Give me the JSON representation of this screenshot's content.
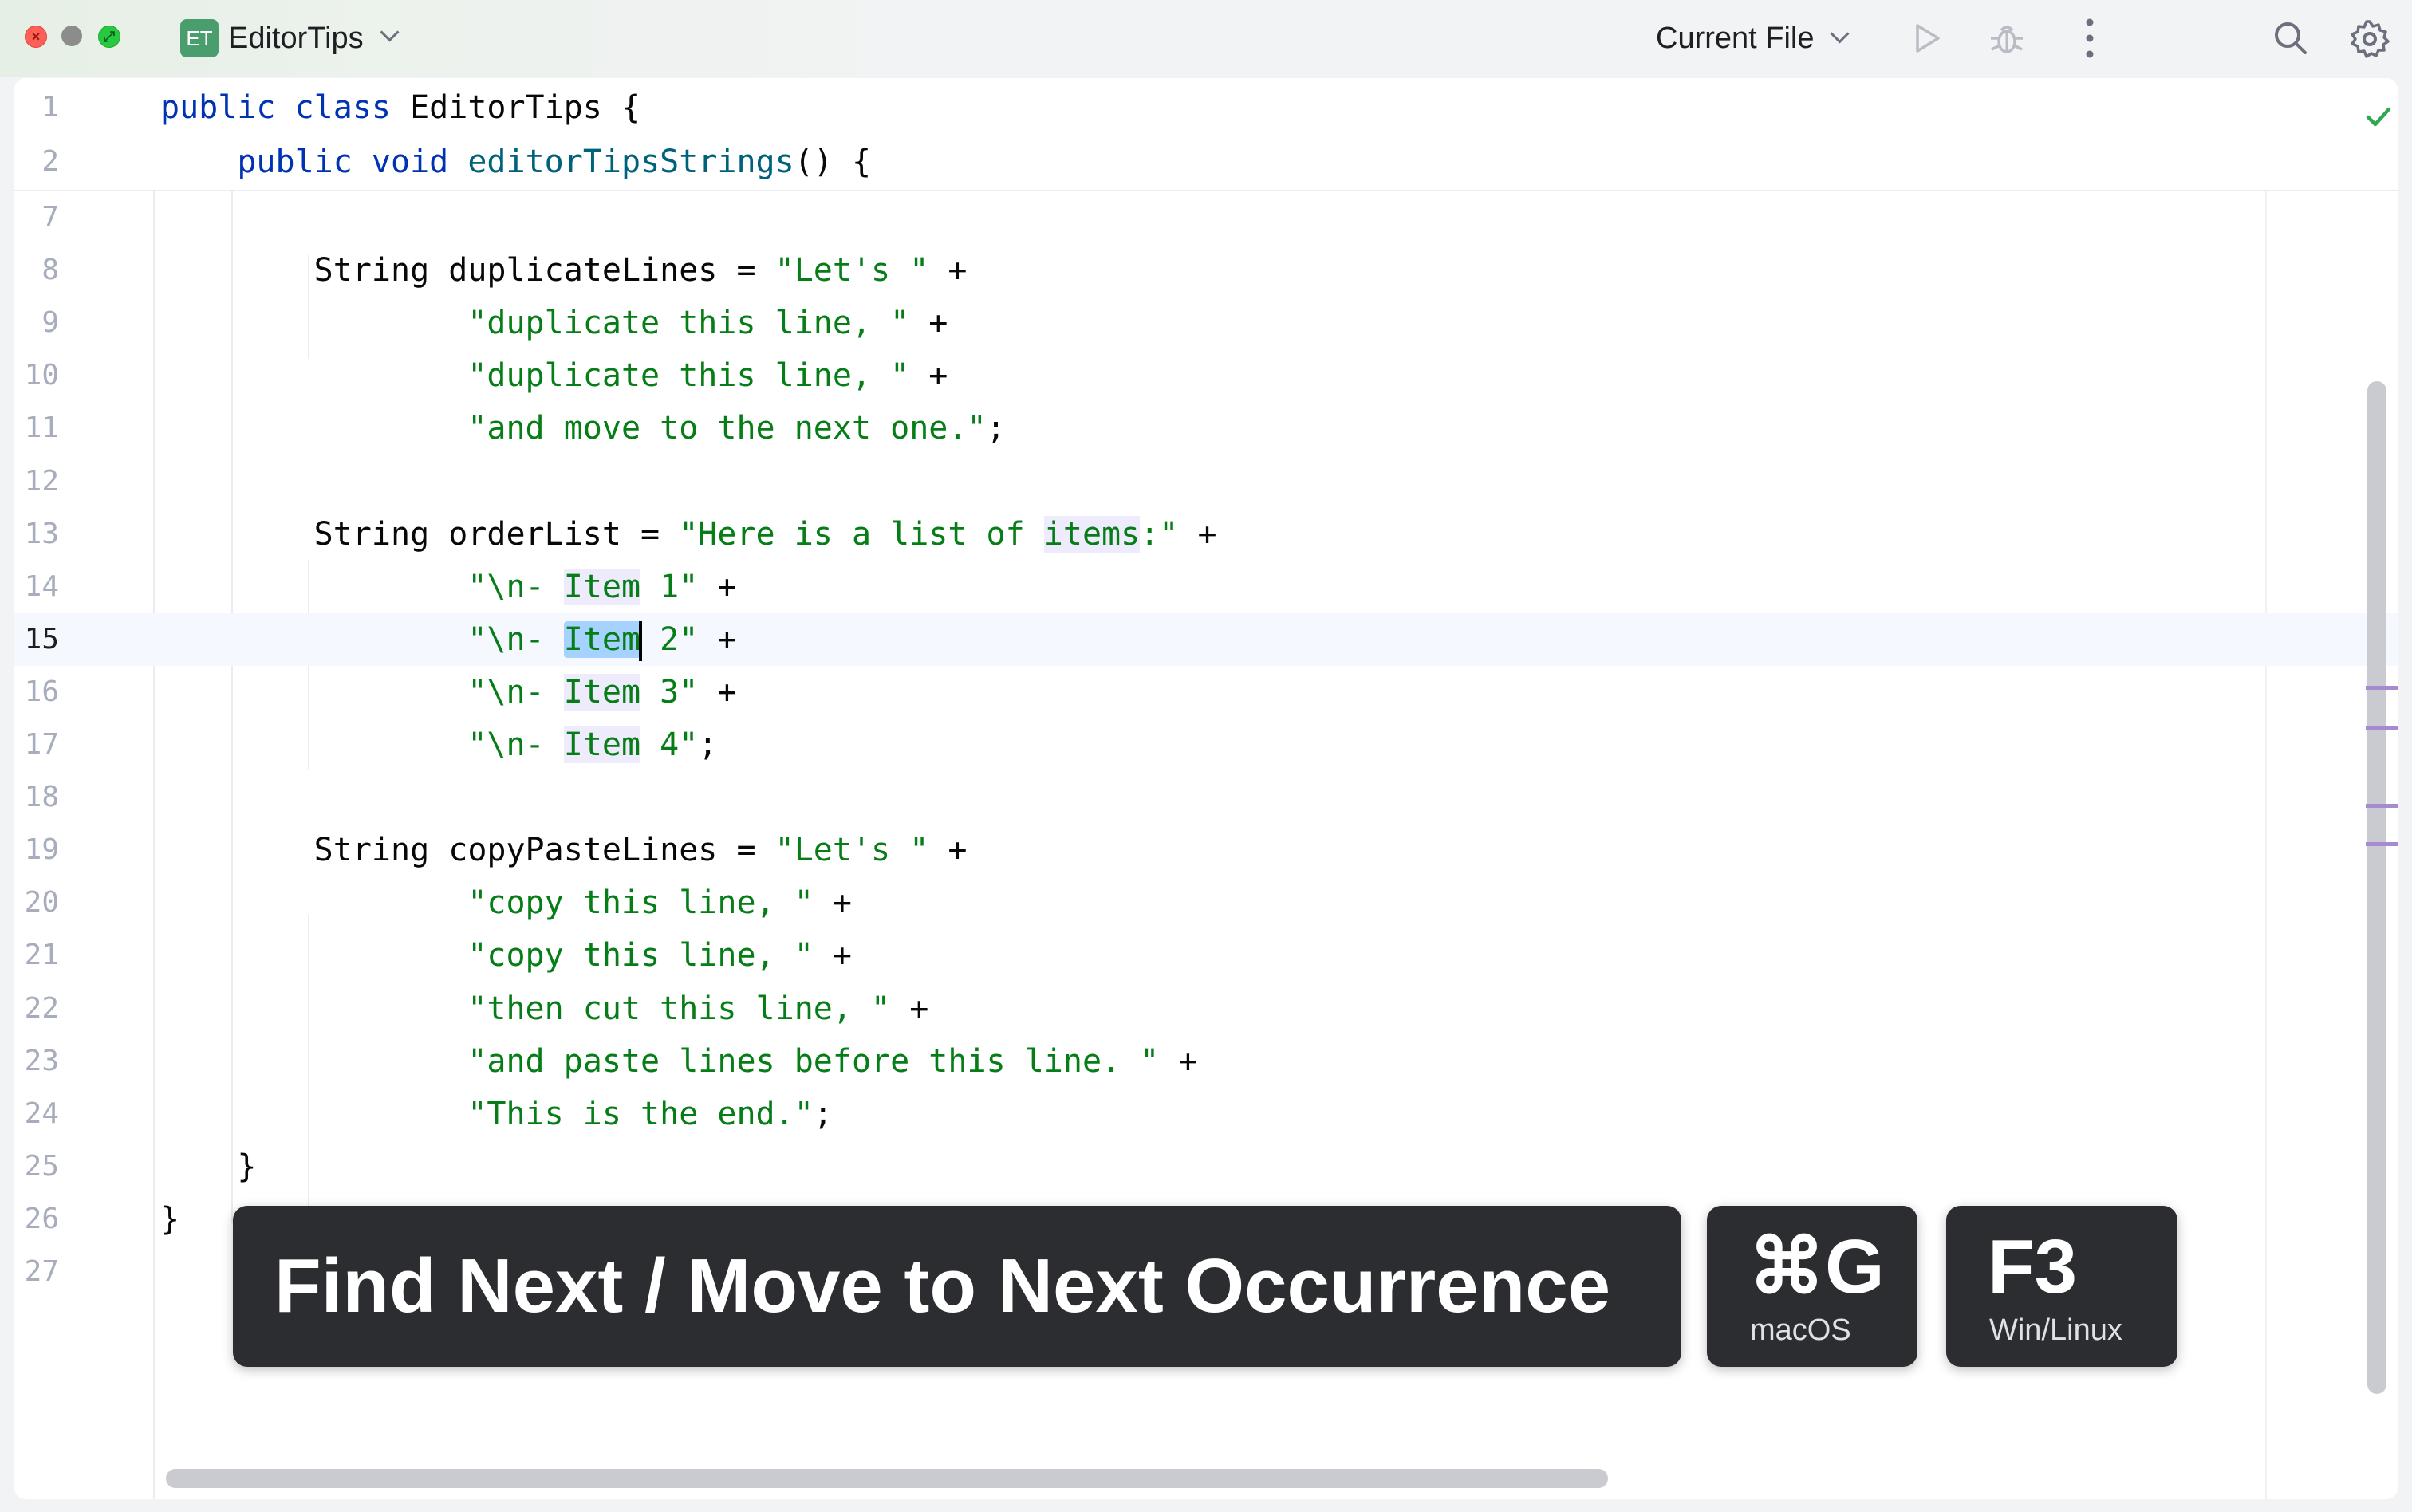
{
  "titlebar": {
    "project_badge": "ET",
    "project_name": "EditorTips",
    "run_config": "Current File",
    "icons": [
      "close-window-icon",
      "minimize-window-icon",
      "zoom-window-icon",
      "chevron-down-icon",
      "run-icon",
      "debug-icon",
      "more-vertical-icon",
      "search-icon",
      "gear-icon"
    ]
  },
  "editor": {
    "status_icon": "check-icon",
    "current_line": "15",
    "sticky_lines": [
      {
        "num": "1",
        "tokens": [
          {
            "t": "public class",
            "c": "kw"
          },
          {
            "t": " EditorTips {",
            "c": ""
          }
        ]
      },
      {
        "num": "2",
        "tokens": [
          {
            "t": "    public void",
            "c": "kw"
          },
          {
            "t": " ",
            "c": ""
          },
          {
            "t": "editorTipsStrings",
            "c": "fn"
          },
          {
            "t": "() {",
            "c": ""
          }
        ]
      }
    ],
    "lines": [
      {
        "num": "7",
        "tokens": []
      },
      {
        "num": "8",
        "tokens": [
          {
            "t": "        String duplicateLines = ",
            "c": ""
          },
          {
            "t": "\"Let's \"",
            "c": "str"
          },
          {
            "t": " +",
            "c": ""
          }
        ]
      },
      {
        "num": "9",
        "tokens": [
          {
            "t": "                ",
            "c": ""
          },
          {
            "t": "\"duplicate this line, \"",
            "c": "str"
          },
          {
            "t": " +",
            "c": ""
          }
        ]
      },
      {
        "num": "10",
        "tokens": [
          {
            "t": "                ",
            "c": ""
          },
          {
            "t": "\"duplicate this line, \"",
            "c": "str"
          },
          {
            "t": " +",
            "c": ""
          }
        ]
      },
      {
        "num": "11",
        "tokens": [
          {
            "t": "                ",
            "c": ""
          },
          {
            "t": "\"and move to the next one.\"",
            "c": "str"
          },
          {
            "t": ";",
            "c": ""
          }
        ]
      },
      {
        "num": "12",
        "tokens": []
      },
      {
        "num": "13",
        "tokens": [
          {
            "t": "        String orderList = ",
            "c": ""
          },
          {
            "t": "\"Here is a list of ",
            "c": "str"
          },
          {
            "t": "items",
            "c": "str occ"
          },
          {
            "t": ":\"",
            "c": "str"
          },
          {
            "t": " +",
            "c": ""
          }
        ]
      },
      {
        "num": "14",
        "tokens": [
          {
            "t": "                ",
            "c": ""
          },
          {
            "t": "\"\\n- ",
            "c": "str"
          },
          {
            "t": "Item",
            "c": "str occ"
          },
          {
            "t": " 1\"",
            "c": "str"
          },
          {
            "t": " +",
            "c": ""
          }
        ]
      },
      {
        "num": "15",
        "tokens": [
          {
            "t": "                ",
            "c": ""
          },
          {
            "t": "\"\\n- ",
            "c": "str"
          },
          {
            "t": "Item",
            "c": "str sel"
          },
          {
            "t": "",
            "c": "caret"
          },
          {
            "t": " 2\"",
            "c": "str"
          },
          {
            "t": " +",
            "c": ""
          }
        ]
      },
      {
        "num": "16",
        "tokens": [
          {
            "t": "                ",
            "c": ""
          },
          {
            "t": "\"\\n- ",
            "c": "str"
          },
          {
            "t": "Item",
            "c": "str occ"
          },
          {
            "t": " 3\"",
            "c": "str"
          },
          {
            "t": " +",
            "c": ""
          }
        ]
      },
      {
        "num": "17",
        "tokens": [
          {
            "t": "                ",
            "c": ""
          },
          {
            "t": "\"\\n- ",
            "c": "str"
          },
          {
            "t": "Item",
            "c": "str occ"
          },
          {
            "t": " 4\"",
            "c": "str"
          },
          {
            "t": ";",
            "c": ""
          }
        ]
      },
      {
        "num": "18",
        "tokens": []
      },
      {
        "num": "19",
        "tokens": [
          {
            "t": "        String copyPasteLines = ",
            "c": ""
          },
          {
            "t": "\"Let's \"",
            "c": "str"
          },
          {
            "t": " +",
            "c": ""
          }
        ]
      },
      {
        "num": "20",
        "tokens": [
          {
            "t": "                ",
            "c": ""
          },
          {
            "t": "\"copy this line, \"",
            "c": "str"
          },
          {
            "t": " +",
            "c": ""
          }
        ]
      },
      {
        "num": "21",
        "tokens": [
          {
            "t": "                ",
            "c": ""
          },
          {
            "t": "\"copy this line, \"",
            "c": "str"
          },
          {
            "t": " +",
            "c": ""
          }
        ]
      },
      {
        "num": "22",
        "tokens": [
          {
            "t": "                ",
            "c": ""
          },
          {
            "t": "\"then cut this line, \"",
            "c": "str"
          },
          {
            "t": " +",
            "c": ""
          }
        ]
      },
      {
        "num": "23",
        "tokens": [
          {
            "t": "                ",
            "c": ""
          },
          {
            "t": "\"and paste lines before this line. \"",
            "c": "str"
          },
          {
            "t": " +",
            "c": ""
          }
        ]
      },
      {
        "num": "24",
        "tokens": [
          {
            "t": "                ",
            "c": ""
          },
          {
            "t": "\"This is the end.\"",
            "c": "str"
          },
          {
            "t": ";",
            "c": ""
          }
        ]
      },
      {
        "num": "25",
        "tokens": [
          {
            "t": "    }",
            "c": ""
          }
        ]
      },
      {
        "num": "26",
        "tokens": [
          {
            "t": "}",
            "c": ""
          }
        ]
      },
      {
        "num": "27",
        "tokens": []
      }
    ]
  },
  "shortcut_overlay": {
    "action": "Find Next / Move to Next Occurrence",
    "mac_key": "⌘G",
    "mac_label": "macOS",
    "win_key": "F3",
    "win_label": "Win/Linux"
  },
  "colors": {
    "keyword": "#0033b3",
    "function": "#00627a",
    "string": "#067d17",
    "selection": "#a6d2ff",
    "occurrence": "#edebfc",
    "overlay_bg": "#2b2d30"
  }
}
